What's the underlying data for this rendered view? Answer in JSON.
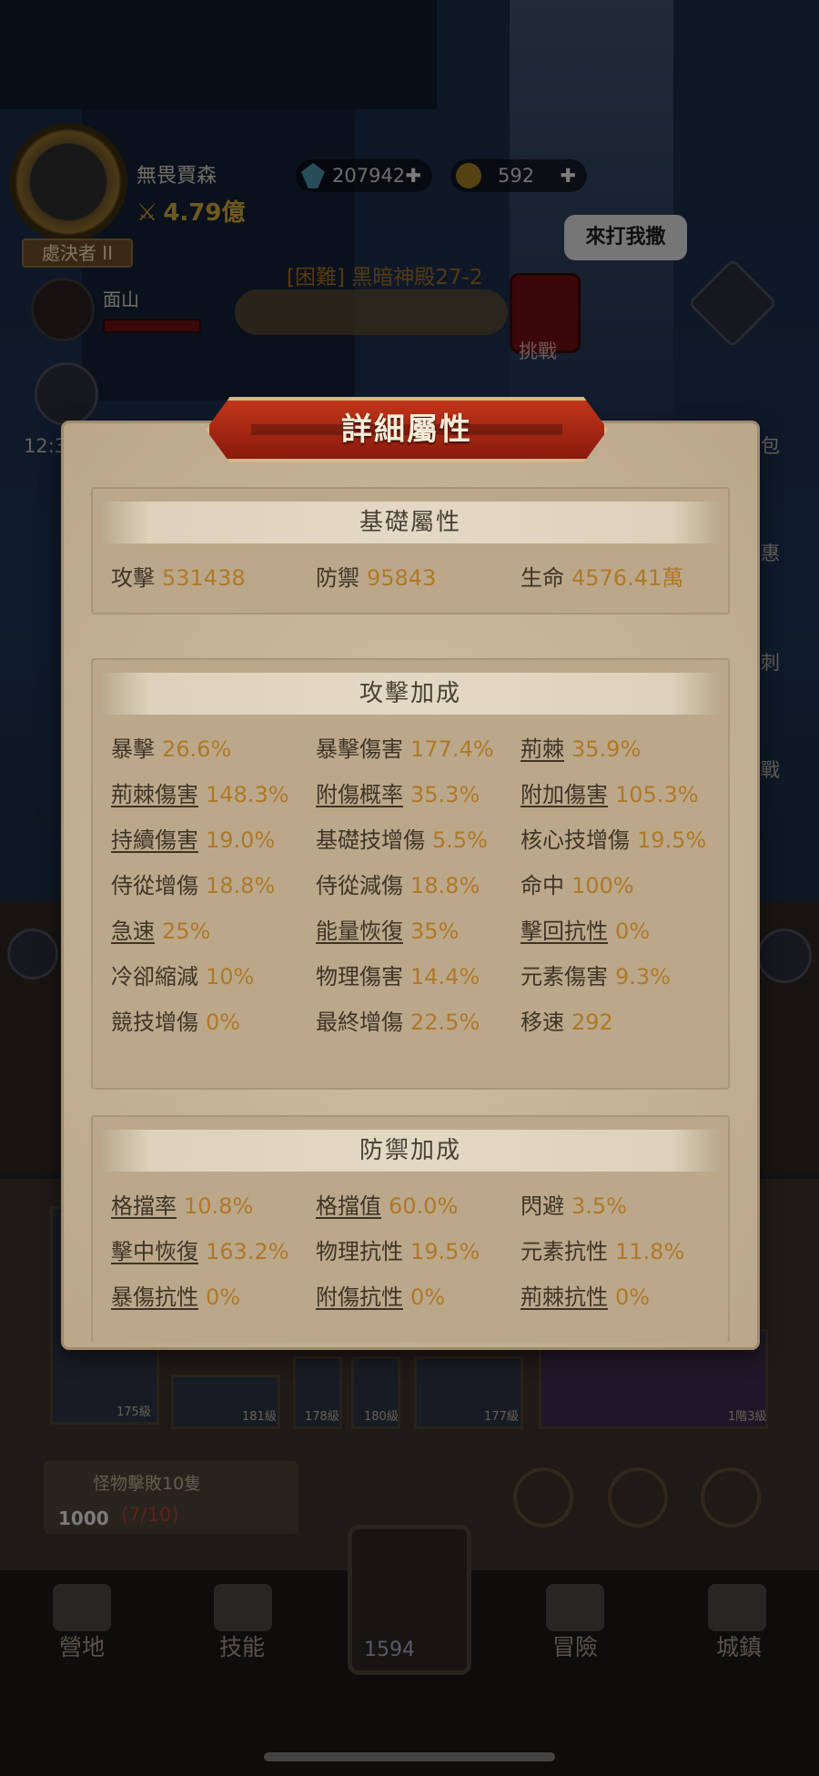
{
  "player": {
    "name": "無畏賈森",
    "power": "4.79億",
    "rank": "處決者 II"
  },
  "currency": {
    "gems": "207942",
    "coins": "592"
  },
  "pet": {
    "name": "面山"
  },
  "stage": {
    "title": "[困難] 黑暗神殿27-2",
    "challenge_label": "挑戰",
    "speech": "來打我撒"
  },
  "side_labels": {
    "left_timer": "12:3",
    "bag": "包",
    "deal": "惠",
    "thorn": "刺",
    "battle": "戰"
  },
  "mission": {
    "text": "怪物擊敗10隻",
    "progress": "(7/10)",
    "reward_count": "1000"
  },
  "gear_levels": [
    "175級",
    "181級",
    "178級",
    "180級",
    "177級",
    "1階3級"
  ],
  "nav": {
    "camp": "營地",
    "skills": "技能",
    "center_value": "1594",
    "adventure": "冒險",
    "town": "城鎮"
  },
  "modal": {
    "title": "詳細屬性",
    "sections": [
      {
        "title": "基礎屬性",
        "stats": [
          {
            "label": "攻擊",
            "value": "531438",
            "underline": false
          },
          {
            "label": "防禦",
            "value": "95843",
            "underline": false
          },
          {
            "label": "生命",
            "value": "4576.41萬",
            "underline": false
          }
        ]
      },
      {
        "title": "攻擊加成",
        "stats": [
          {
            "label": "暴擊",
            "value": "26.6%",
            "underline": false
          },
          {
            "label": "暴擊傷害",
            "value": "177.4%",
            "underline": false
          },
          {
            "label": "荊棘",
            "value": "35.9%",
            "underline": true
          },
          {
            "label": "荊棘傷害",
            "value": "148.3%",
            "underline": true
          },
          {
            "label": "附傷概率",
            "value": "35.3%",
            "underline": true
          },
          {
            "label": "附加傷害",
            "value": "105.3%",
            "underline": true
          },
          {
            "label": "持續傷害",
            "value": "19.0%",
            "underline": true
          },
          {
            "label": "基礎技增傷",
            "value": "5.5%",
            "underline": false
          },
          {
            "label": "核心技增傷",
            "value": "19.5%",
            "underline": false
          },
          {
            "label": "侍從增傷",
            "value": "18.8%",
            "underline": false
          },
          {
            "label": "侍從減傷",
            "value": "18.8%",
            "underline": false
          },
          {
            "label": "命中",
            "value": "100%",
            "underline": false
          },
          {
            "label": "急速",
            "value": "25%",
            "underline": true
          },
          {
            "label": "能量恢復",
            "value": "35%",
            "underline": true
          },
          {
            "label": "擊回抗性",
            "value": "0%",
            "underline": true
          },
          {
            "label": "冷卻縮減",
            "value": "10%",
            "underline": false
          },
          {
            "label": "物理傷害",
            "value": "14.4%",
            "underline": false
          },
          {
            "label": "元素傷害",
            "value": "9.3%",
            "underline": false
          },
          {
            "label": "競技增傷",
            "value": "0%",
            "underline": false
          },
          {
            "label": "最終增傷",
            "value": "22.5%",
            "underline": false
          },
          {
            "label": "移速",
            "value": "292",
            "underline": false
          }
        ]
      },
      {
        "title": "防禦加成",
        "stats": [
          {
            "label": "格擋率",
            "value": "10.8%",
            "underline": true
          },
          {
            "label": "格擋值",
            "value": "60.0%",
            "underline": true
          },
          {
            "label": "閃避",
            "value": "3.5%",
            "underline": false
          },
          {
            "label": "擊中恢復",
            "value": "163.2%",
            "underline": true
          },
          {
            "label": "物理抗性",
            "value": "19.5%",
            "underline": false
          },
          {
            "label": "元素抗性",
            "value": "11.8%",
            "underline": false
          },
          {
            "label": "暴傷抗性",
            "value": "0%",
            "underline": true
          },
          {
            "label": "附傷抗性",
            "value": "0%",
            "underline": true
          },
          {
            "label": "荊棘抗性",
            "value": "0%",
            "underline": true
          }
        ]
      }
    ]
  },
  "colors": {
    "modal_bg": "#c9b79a",
    "stat_value": "#b07828",
    "stat_label": "#3e3428",
    "title_red": "#c0361a"
  }
}
